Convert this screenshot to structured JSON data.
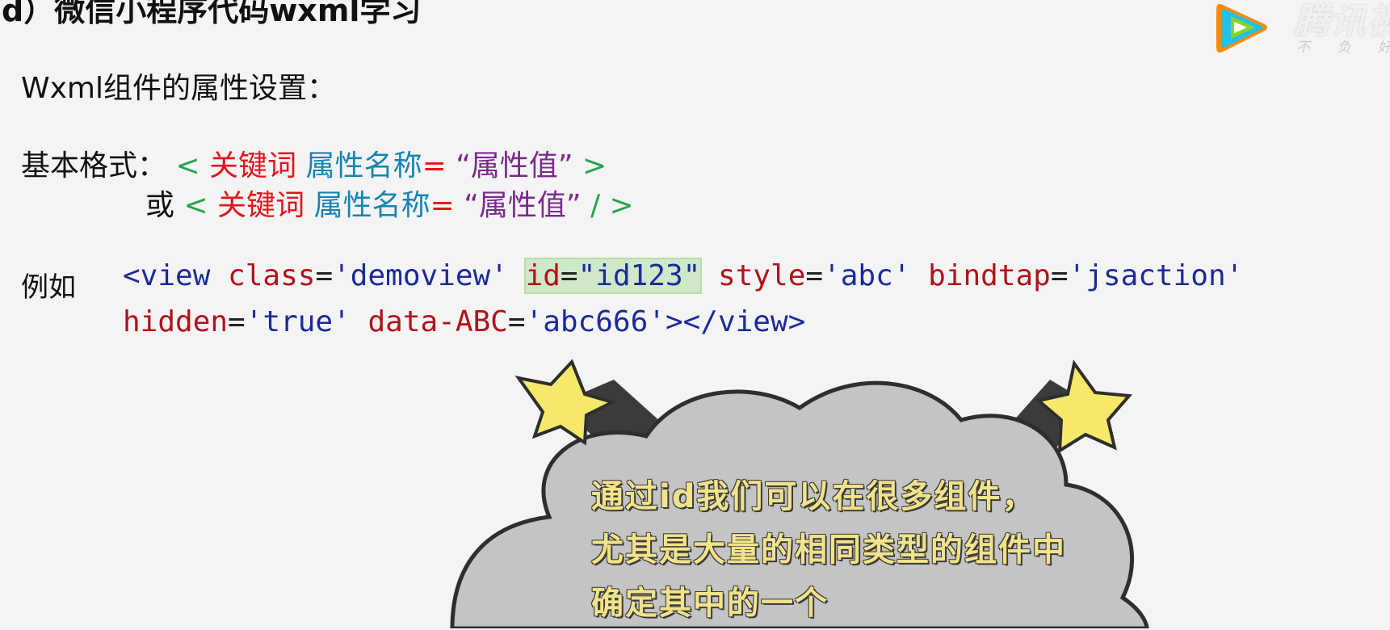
{
  "header": {
    "title": "d）微信小程序代码wxml学习"
  },
  "logo": {
    "name": "腾讯视",
    "slogan": "不 负 好",
    "colors": [
      "#ff8a00",
      "#24c1e7",
      "#8ad321"
    ]
  },
  "content": {
    "subtitle": "Wxml组件的属性设置：",
    "format": {
      "label": "基本格式：",
      "or_label": "或",
      "open": "<",
      "keyword": "关键词",
      "attr_name": "属性名称",
      "equals": "=",
      "attr_value": "“属性值”",
      "close1": ">",
      "close2": "/ >"
    },
    "example": {
      "label": "例如",
      "line1": {
        "tag_open": "<view",
        "attr1": "class",
        "val1": "'demoview'",
        "attr2": "id",
        "val2": "\"id123\"",
        "attr3": "style",
        "val3": "'abc'",
        "attr4": "bindtap",
        "val4": "'jsaction'",
        "eq": "="
      },
      "line2": {
        "attr5": "hidden",
        "val5": "'true'",
        "attr6": "data-ABC",
        "val6": "'abc666'",
        "tag_close": "></view>",
        "eq": "="
      }
    }
  },
  "callout": {
    "lines": [
      "通过id我们可以在很多组件，",
      "尤其是大量的相同类型的组件中",
      "确定其中的一个"
    ]
  },
  "colors": {
    "green": "#27a34a",
    "red": "#e0161b",
    "blue": "#1584b5",
    "purple": "#7a2a8c",
    "cloud": "#c4c4c4",
    "star": "#f6e86a",
    "callout_text": "#f2e38a"
  }
}
